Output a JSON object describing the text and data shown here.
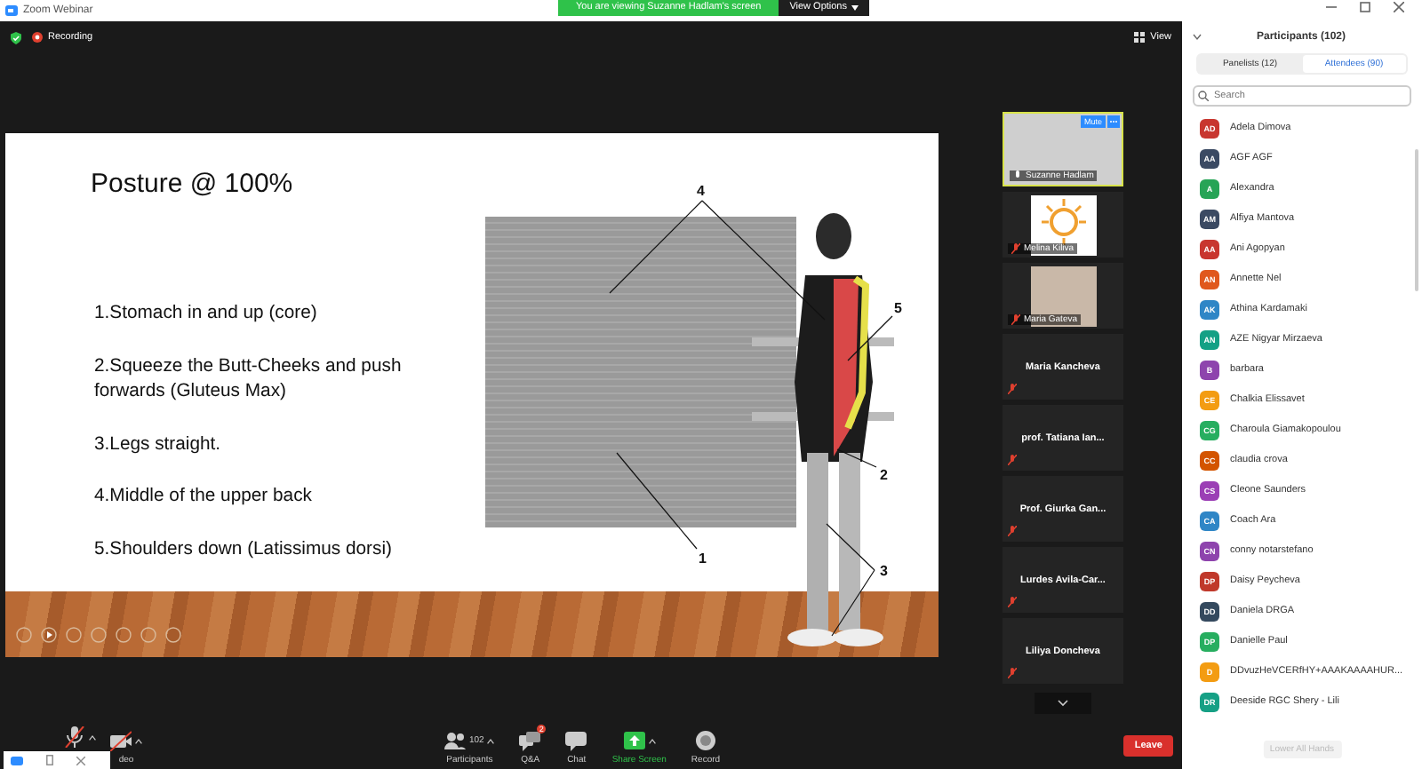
{
  "window": {
    "title": "Zoom Webinar"
  },
  "banner": {
    "text": "You are viewing Suzanne Hadlam's screen",
    "view_options": "View Options"
  },
  "top_bar": {
    "recording": "Recording",
    "view": "View"
  },
  "slide": {
    "title": "Posture @ 100%",
    "points": [
      "1.Stomach in and up (core)",
      "2.Squeeze the Butt-Cheeks and push forwards (Gluteus Max)",
      "3.Legs straight.",
      "4.Middle of the upper back",
      "5.Shoulders down (Latissimus dorsi)"
    ],
    "callouts": [
      "4",
      "5",
      "2",
      "1",
      "3"
    ]
  },
  "video_tiles": [
    {
      "name": "Suzanne Hadlam",
      "kind": "video",
      "muted": false,
      "active": true,
      "mute_button": "Mute"
    },
    {
      "name": "Melina Kiliva",
      "kind": "logo",
      "muted": true,
      "active": false
    },
    {
      "name": "Maria Gateva",
      "kind": "video",
      "muted": true,
      "active": false
    },
    {
      "name": "Maria Kancheva",
      "kind": "name",
      "muted": true,
      "active": false
    },
    {
      "name": "prof. Tatiana Ian...",
      "kind": "name",
      "muted": true,
      "active": false
    },
    {
      "name": "Prof. Giurka Gan...",
      "kind": "name",
      "muted": true,
      "active": false
    },
    {
      "name": "Lurdes  Avila-Car...",
      "kind": "name",
      "muted": true,
      "active": false
    },
    {
      "name": "Liliya Doncheva",
      "kind": "name",
      "muted": true,
      "active": false
    }
  ],
  "participants": {
    "title": "Participants (102)",
    "tabs": [
      {
        "label": "Panelists (12)",
        "selected": false
      },
      {
        "label": "Attendees (90)",
        "selected": true
      }
    ],
    "search": {
      "placeholder": "Search"
    },
    "items": [
      {
        "initials": "AD",
        "name": "Adela Dimova",
        "color": "#c8362f"
      },
      {
        "initials": "AA",
        "name": "AGF AGF",
        "color": "#3b4a63"
      },
      {
        "initials": "A",
        "name": "Alexandra",
        "color": "#27a456"
      },
      {
        "initials": "AM",
        "name": "Alfiya Mantova",
        "color": "#3b4a63"
      },
      {
        "initials": "AA",
        "name": "Ani Agopyan",
        "color": "#c8362f"
      },
      {
        "initials": "AN",
        "name": "Annette Nel",
        "color": "#e0581d"
      },
      {
        "initials": "AK",
        "name": "Athina Kardamaki",
        "color": "#2f86c6"
      },
      {
        "initials": "AN",
        "name": "AZE Nigyar Mirzaeva",
        "color": "#14a085"
      },
      {
        "initials": "B",
        "name": "barbara",
        "color": "#8e44ad"
      },
      {
        "initials": "CE",
        "name": "Chalkia Elissavet",
        "color": "#f39c12"
      },
      {
        "initials": "CG",
        "name": "Charoula Giamakopoulou",
        "color": "#27ae60"
      },
      {
        "initials": "CC",
        "name": "claudia crova",
        "color": "#d35400"
      },
      {
        "initials": "CS",
        "name": "Cleone Saunders",
        "color": "#9b3fb5"
      },
      {
        "initials": "CA",
        "name": "Coach Ara",
        "color": "#2f86c6"
      },
      {
        "initials": "CN",
        "name": "conny notarstefano",
        "color": "#8e44ad"
      },
      {
        "initials": "DP",
        "name": "Daisy Peycheva",
        "color": "#c0392b"
      },
      {
        "initials": "DD",
        "name": "Daniela DRGA",
        "color": "#34495e"
      },
      {
        "initials": "DP",
        "name": "Danielle Paul",
        "color": "#27ae60"
      },
      {
        "initials": "D",
        "name": "DDvuzHeVCERfHY+AAAKAAAAHUR...",
        "color": "#f39c12"
      },
      {
        "initials": "DR",
        "name": "Deeside RGC Shery - Lili",
        "color": "#16a085"
      }
    ],
    "lower_all_hands": {
      "label": "Lower All Hands",
      "disabled": true
    }
  },
  "toolbar": {
    "items": [
      {
        "kind": "mic"
      },
      {
        "kind": "video",
        "label": "deo"
      },
      {
        "kind": "participants",
        "label": "Participants",
        "count": "102"
      },
      {
        "kind": "qa",
        "label": "Q&A",
        "badge": "2"
      },
      {
        "kind": "chat",
        "label": "Chat"
      },
      {
        "kind": "share",
        "label": "Share Screen"
      },
      {
        "kind": "record",
        "label": "Record"
      }
    ],
    "leave": "Leave"
  }
}
